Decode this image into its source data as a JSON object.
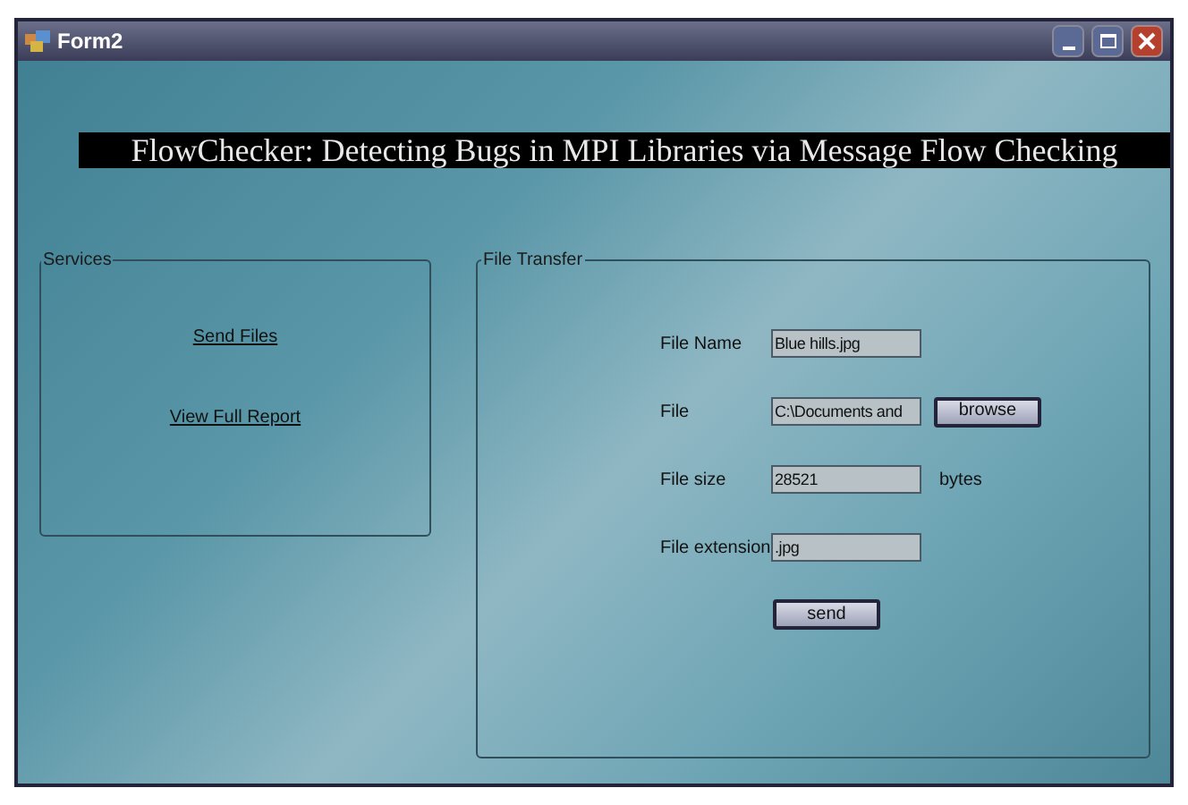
{
  "window": {
    "title": "Form2"
  },
  "banner": "FlowChecker: Detecting Bugs in MPI Libraries via Message Flow Checking",
  "services": {
    "title": "Services",
    "links": [
      "Send Files",
      "View Full Report"
    ]
  },
  "file_transfer": {
    "title": "File Transfer",
    "fields": [
      {
        "label": "File Name",
        "value": "Blue hills.jpg"
      },
      {
        "label": "File",
        "value": "C:\\Documents and",
        "button": "browse"
      },
      {
        "label": "File size",
        "value": "28521",
        "suffix": "bytes"
      },
      {
        "label": "File extension",
        "value": ".jpg"
      }
    ],
    "send_button": "send"
  }
}
